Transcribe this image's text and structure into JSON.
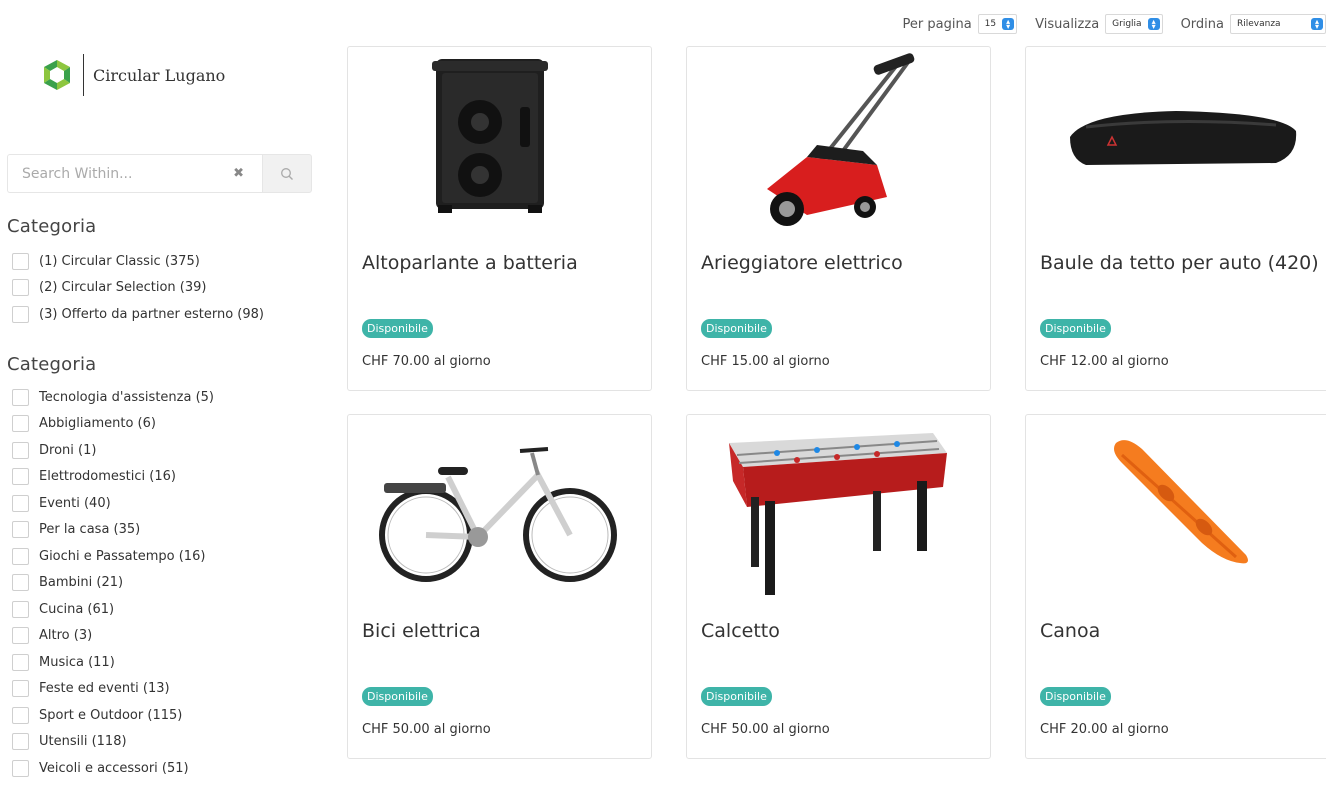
{
  "toolbar": {
    "per_page_label": "Per pagina",
    "per_page_value": "15",
    "view_label": "Visualizza",
    "view_value": "Griglia",
    "sort_label": "Ordina",
    "sort_value": "Rilevanza"
  },
  "brand": {
    "name": "Circular Lugano"
  },
  "search": {
    "placeholder": "Search Within..."
  },
  "filters": [
    {
      "heading": "Categoria",
      "items": [
        "(1) Circular Classic (375)",
        "(2) Circular Selection (39)",
        "(3) Offerto da partner esterno (98)"
      ]
    },
    {
      "heading": "Categoria",
      "items": [
        "Tecnologia d'assistenza (5)",
        "Abbigliamento (6)",
        "Droni (1)",
        "Elettrodomestici (16)",
        "Eventi (40)",
        "Per la casa (35)",
        "Giochi e Passatempo (16)",
        "Bambini (21)",
        "Cucina (61)",
        "Altro (3)",
        "Musica (11)",
        "Feste ed eventi (13)",
        "Sport e Outdoor (115)",
        "Utensili (118)",
        "Veicoli e accessori (51)"
      ]
    }
  ],
  "products": [
    {
      "title": "Altoparlante a batteria",
      "status": "Disponibile",
      "price": "CHF 70.00 al giorno",
      "icon": "speaker-image"
    },
    {
      "title": "Arieggiatore elettrico",
      "status": "Disponibile",
      "price": "CHF 15.00 al giorno",
      "icon": "lawn-scarifier-image"
    },
    {
      "title": "Baule da tetto per auto (420)",
      "status": "Disponibile",
      "price": "CHF 12.00 al giorno",
      "icon": "roof-box-image"
    },
    {
      "title": "Bici elettrica",
      "status": "Disponibile",
      "price": "CHF 50.00 al giorno",
      "icon": "e-bike-image"
    },
    {
      "title": "Calcetto",
      "status": "Disponibile",
      "price": "CHF 50.00 al giorno",
      "icon": "foosball-table-image"
    },
    {
      "title": "Canoa",
      "status": "Disponibile",
      "price": "CHF 20.00 al giorno",
      "icon": "canoe-image"
    }
  ],
  "colors": {
    "badge": "#3eb4a8",
    "select_caret": "#2f8ee6",
    "logo_green_dark": "#3aa14a",
    "logo_green_light": "#8dc63f"
  }
}
